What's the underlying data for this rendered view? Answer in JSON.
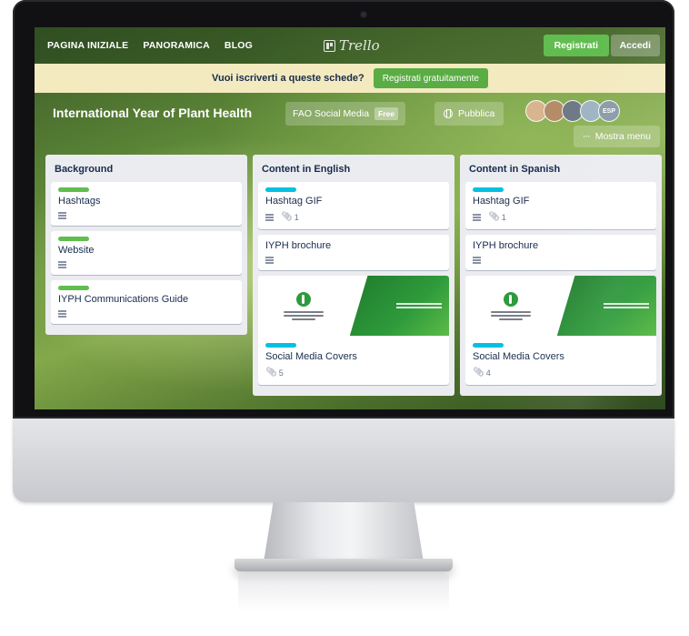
{
  "nav": {
    "links": [
      "PAGINA INIZIALE",
      "PANORAMICA",
      "BLOG"
    ],
    "logo_text": "Trello",
    "register_label": "Registrati",
    "login_label": "Accedi"
  },
  "banner": {
    "text": "Vuoi iscriverti a queste schede?",
    "button_label": "Registrati gratuitamente"
  },
  "board": {
    "title": "International Year of Plant Health",
    "team_label": "FAO Social Media",
    "team_badge": "Free",
    "visibility_label": "Pubblica",
    "member_initials": "ESP",
    "menu_label": "Mostra menu"
  },
  "lists": [
    {
      "title": "Background",
      "cards": [
        {
          "title": "Hashtags",
          "label_color": "green"
        },
        {
          "title": "Website",
          "label_color": "green"
        },
        {
          "title": "IYPH Communications Guide",
          "label_color": "green"
        }
      ]
    },
    {
      "title": "Content in English",
      "cards": [
        {
          "title": "Hashtag GIF",
          "label_color": "blue",
          "attachments": "1"
        },
        {
          "title": "IYPH brochure"
        },
        {
          "title": "Social Media Covers",
          "label_color": "blue",
          "attachments": "5"
        }
      ]
    },
    {
      "title": "Content in Spanish",
      "cards": [
        {
          "title": "Hashtag GIF",
          "label_color": "blue",
          "attachments": "1"
        },
        {
          "title": "IYPH brochure"
        },
        {
          "title": "Social Media Covers",
          "label_color": "blue",
          "attachments": "4"
        }
      ]
    }
  ],
  "colors": {
    "nav_bg": "#2f4a1f",
    "banner_bg": "#f3eac0",
    "primary_green": "#61bd4f",
    "label_green": "#61bd4f",
    "label_blue": "#00c2e0",
    "list_bg": "#ebecf0"
  }
}
